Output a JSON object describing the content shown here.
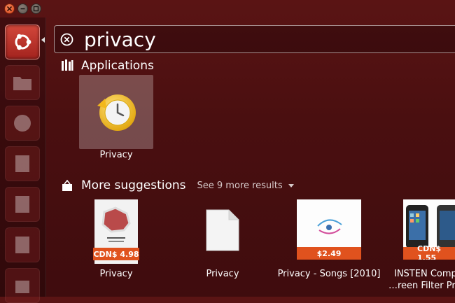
{
  "search": {
    "query": "privacy"
  },
  "applications": {
    "header": "Applications",
    "items": [
      {
        "label": "Privacy"
      }
    ]
  },
  "suggestions": {
    "header": "More suggestions",
    "see_more": "See 9 more results",
    "items": [
      {
        "label": "Privacy",
        "price": "CDN$ 4.98"
      },
      {
        "label": "Privacy",
        "price": ""
      },
      {
        "label": "Privacy - Songs [2010]",
        "price": "$2.49"
      },
      {
        "label_line1": "INSTEN Comp",
        "label_line2": "…reen Filter Pro",
        "price": "CDN$ 1.55"
      }
    ]
  },
  "colors": {
    "accent": "#e0521e",
    "dash": "#c23a31",
    "background": "#4a0f10"
  }
}
